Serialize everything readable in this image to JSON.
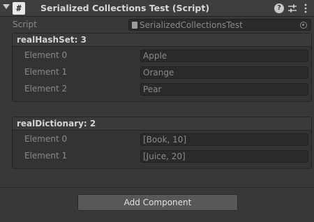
{
  "header": {
    "title": "Serialized Collections Test (Script)",
    "script_icon_glyph": "#",
    "help_glyph": "?",
    "icons": [
      "foldout-arrow-icon",
      "csharp-script-icon",
      "help-icon",
      "preset-sliders-icon",
      "kebab-menu-icon"
    ]
  },
  "script_field": {
    "label": "Script",
    "value": "SerializedCollectionsTest"
  },
  "hash_set": {
    "title": "realHashSet: 3",
    "elements": [
      {
        "label": "Element 0",
        "value": "Apple"
      },
      {
        "label": "Element 1",
        "value": "Orange"
      },
      {
        "label": "Element 2",
        "value": "Pear"
      }
    ]
  },
  "dictionary": {
    "title": "realDictionary: 2",
    "elements": [
      {
        "label": "Element 0",
        "value": "[Book, 10]"
      },
      {
        "label": "Element 1",
        "value": "[Juice, 20]"
      }
    ]
  },
  "add_component_label": "Add Component",
  "colors": {
    "background": "#383838",
    "header": "#3e3e3e",
    "field": "#2a2a2a",
    "button": "#585858"
  }
}
